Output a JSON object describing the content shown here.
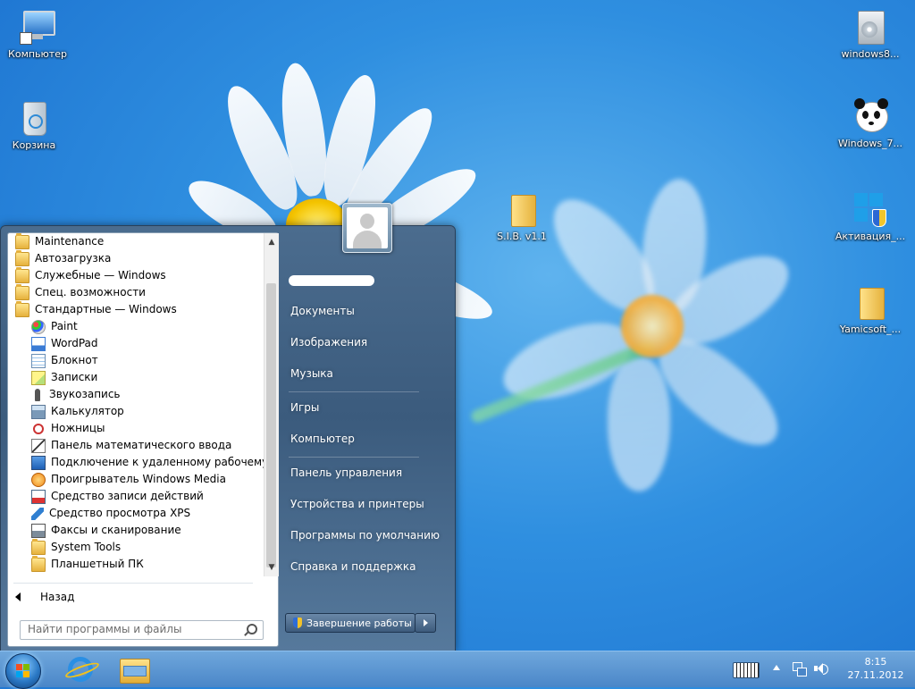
{
  "desktop": {
    "icons": [
      {
        "label": "Компьютер",
        "icon": "computer-icon"
      },
      {
        "label": "Корзина",
        "icon": "recycle-bin-icon"
      },
      {
        "label": "S.I.B. v1.1",
        "icon": "folder-icon"
      },
      {
        "label": "windows8...",
        "icon": "installer-icon"
      },
      {
        "label": "Windows_7...",
        "icon": "panda-icon"
      },
      {
        "label": "Активация_...",
        "icon": "windows-shield-icon"
      },
      {
        "label": "Yamicsoft_...",
        "icon": "folder-icon"
      }
    ]
  },
  "start_menu": {
    "programs": [
      {
        "label": "Maintenance",
        "icon": "folder-icon",
        "level": 0
      },
      {
        "label": "Автозагрузка",
        "icon": "folder-icon",
        "level": 0
      },
      {
        "label": "Служебные — Windows",
        "icon": "folder-icon",
        "level": 0
      },
      {
        "label": "Спец. возможности",
        "icon": "folder-icon",
        "level": 0
      },
      {
        "label": "Стандартные — Windows",
        "icon": "folder-icon",
        "level": 0
      },
      {
        "label": "Paint",
        "icon": "paint-icon",
        "level": 1
      },
      {
        "label": "WordPad",
        "icon": "wordpad-icon",
        "level": 1
      },
      {
        "label": "Блокнот",
        "icon": "notepad-icon",
        "level": 1
      },
      {
        "label": "Записки",
        "icon": "sticky-notes-icon",
        "level": 1
      },
      {
        "label": "Звукозапись",
        "icon": "microphone-icon",
        "level": 1
      },
      {
        "label": "Калькулятор",
        "icon": "calculator-icon",
        "level": 1
      },
      {
        "label": "Ножницы",
        "icon": "scissors-icon",
        "level": 1
      },
      {
        "label": "Панель математического ввода",
        "icon": "math-input-icon",
        "level": 1
      },
      {
        "label": "Подключение к удаленному рабочему стол",
        "icon": "remote-desktop-icon",
        "level": 1
      },
      {
        "label": "Проигрыватель Windows Media",
        "icon": "media-player-icon",
        "level": 1
      },
      {
        "label": "Средство записи действий",
        "icon": "steps-recorder-icon",
        "level": 1
      },
      {
        "label": "Средство просмотра XPS",
        "icon": "xps-viewer-icon",
        "level": 1
      },
      {
        "label": "Факсы и сканирование",
        "icon": "fax-scan-icon",
        "level": 1
      },
      {
        "label": "System Tools",
        "icon": "folder-icon",
        "level": 1
      },
      {
        "label": "Планшетный ПК",
        "icon": "folder-icon",
        "level": 1
      }
    ],
    "back_label": "Назад",
    "search_placeholder": "Найти программы и файлы",
    "right_items": [
      "Документы",
      "Изображения",
      "Музыка",
      "Игры",
      "Компьютер",
      "Панель управления",
      "Устройства и принтеры",
      "Программы по умолчанию",
      "Справка и поддержка"
    ],
    "shutdown_label": "Завершение работы"
  },
  "taskbar": {
    "clock_time": "8:15",
    "clock_date": "27.11.2012"
  }
}
